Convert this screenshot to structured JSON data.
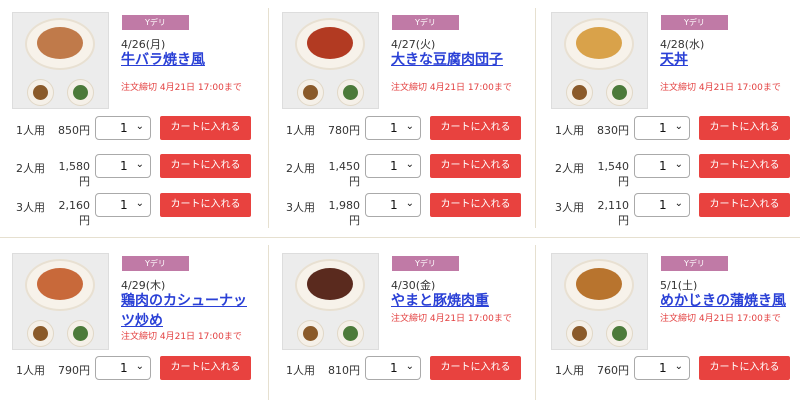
{
  "cards": [
    {
      "tag": "Yデリ",
      "date": "4/26(月)",
      "title": "牛バラ焼き風",
      "deadline": "注文締切 4月21日 17:00まで",
      "food_color": "#c07a4a",
      "options": [
        {
          "label": "1人用",
          "price": "850円",
          "qty": "1",
          "cart": "カートに入れる"
        },
        {
          "label": "2人用",
          "price": "1,580円",
          "qty": "1",
          "cart": "カートに入れる"
        },
        {
          "label": "3人用",
          "price": "2,160円",
          "qty": "1",
          "cart": "カートに入れる"
        }
      ]
    },
    {
      "tag": "Yデリ",
      "date": "4/27(火)",
      "title": "大きな豆腐肉団子",
      "deadline": "注文締切 4月21日 17:00まで",
      "food_color": "#b23a22",
      "options": [
        {
          "label": "1人用",
          "price": "780円",
          "qty": "1",
          "cart": "カートに入れる"
        },
        {
          "label": "2人用",
          "price": "1,450円",
          "qty": "1",
          "cart": "カートに入れる"
        },
        {
          "label": "3人用",
          "price": "1,980円",
          "qty": "1",
          "cart": "カートに入れる"
        }
      ]
    },
    {
      "tag": "Yデリ",
      "date": "4/28(水)",
      "title": "天丼",
      "deadline": "注文締切 4月21日 17:00まで",
      "food_color": "#d9a24a",
      "options": [
        {
          "label": "1人用",
          "price": "830円",
          "qty": "1",
          "cart": "カートに入れる"
        },
        {
          "label": "2人用",
          "price": "1,540円",
          "qty": "1",
          "cart": "カートに入れる"
        },
        {
          "label": "3人用",
          "price": "2,110円",
          "qty": "1",
          "cart": "カートに入れる"
        }
      ]
    },
    {
      "tag": "Yデリ",
      "date": "4/29(木)",
      "title": "鶏肉のカシューナッツ炒め",
      "deadline": "注文締切 4月21日 17:00まで",
      "food_color": "#c8693a",
      "options": [
        {
          "label": "1人用",
          "price": "790円",
          "qty": "1",
          "cart": "カートに入れる"
        }
      ]
    },
    {
      "tag": "Yデリ",
      "date": "4/30(金)",
      "title": "やまと豚焼肉重",
      "deadline": "注文締切 4月21日 17:00まで",
      "food_color": "#5a2a1e",
      "options": [
        {
          "label": "1人用",
          "price": "810円",
          "qty": "1",
          "cart": "カートに入れる"
        }
      ]
    },
    {
      "tag": "Yデリ",
      "date": "5/1(土)",
      "title": "めかじきの蒲焼き風",
      "deadline": "注文締切 4月21日 17:00まで",
      "food_color": "#b8742e",
      "options": [
        {
          "label": "1人用",
          "price": "760円",
          "qty": "1",
          "cart": "カートに入れる"
        }
      ]
    }
  ]
}
